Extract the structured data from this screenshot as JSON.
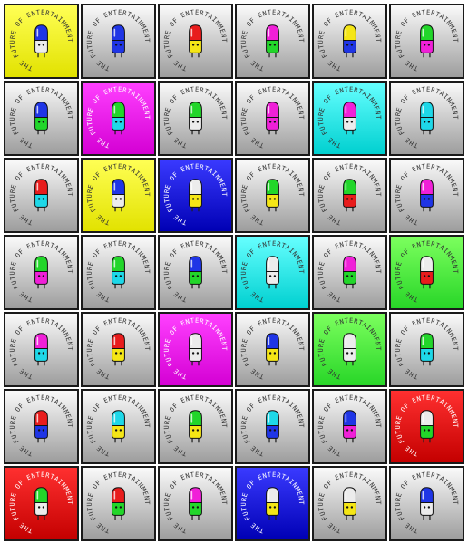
{
  "ring_text": "THE FUTURE OF ENTERTAINMENT",
  "backgrounds": {
    "gray": [
      "#fafafa",
      "#9d9d9d"
    ],
    "yellow": [
      "#ffff55",
      "#e2e200"
    ],
    "magenta": [
      "#ff40ff",
      "#d400d4"
    ],
    "cyan": [
      "#66ffff",
      "#00d0d0"
    ],
    "blue": [
      "#3a3aff",
      "#0000b4"
    ],
    "green": [
      "#7cff5e",
      "#28d628"
    ],
    "red": [
      "#ff3030",
      "#c40000"
    ]
  },
  "body_colors": {
    "blue": "#1f35e6",
    "red": "#e81c1c",
    "yellow": "#f5e616",
    "green": "#22d62a",
    "magenta": "#f020d8",
    "cyan": "#1ed8e8",
    "white": "#ececec"
  },
  "tiles": [
    {
      "bg": "yellow",
      "top": "blue",
      "bottom": "white"
    },
    {
      "bg": "gray",
      "top": "blue",
      "bottom": "blue"
    },
    {
      "bg": "gray",
      "top": "red",
      "bottom": "yellow"
    },
    {
      "bg": "gray",
      "top": "magenta",
      "bottom": "green"
    },
    {
      "bg": "gray",
      "top": "yellow",
      "bottom": "blue"
    },
    {
      "bg": "gray",
      "top": "green",
      "bottom": "magenta"
    },
    {
      "bg": "gray",
      "top": "blue",
      "bottom": "green"
    },
    {
      "bg": "magenta",
      "top": "green",
      "bottom": "cyan"
    },
    {
      "bg": "gray",
      "top": "green",
      "bottom": "white"
    },
    {
      "bg": "gray",
      "top": "magenta",
      "bottom": "magenta"
    },
    {
      "bg": "cyan",
      "top": "magenta",
      "bottom": "white"
    },
    {
      "bg": "gray",
      "top": "cyan",
      "bottom": "cyan"
    },
    {
      "bg": "gray",
      "top": "red",
      "bottom": "cyan"
    },
    {
      "bg": "yellow",
      "top": "blue",
      "bottom": "white"
    },
    {
      "bg": "blue",
      "top": "white",
      "bottom": "yellow"
    },
    {
      "bg": "gray",
      "top": "green",
      "bottom": "yellow"
    },
    {
      "bg": "gray",
      "top": "green",
      "bottom": "red"
    },
    {
      "bg": "gray",
      "top": "magenta",
      "bottom": "blue"
    },
    {
      "bg": "gray",
      "top": "green",
      "bottom": "magenta"
    },
    {
      "bg": "gray",
      "top": "green",
      "bottom": "cyan"
    },
    {
      "bg": "gray",
      "top": "blue",
      "bottom": "green"
    },
    {
      "bg": "cyan",
      "top": "white",
      "bottom": "white"
    },
    {
      "bg": "gray",
      "top": "magenta",
      "bottom": "green"
    },
    {
      "bg": "green",
      "top": "white",
      "bottom": "red"
    },
    {
      "bg": "gray",
      "top": "magenta",
      "bottom": "cyan"
    },
    {
      "bg": "gray",
      "top": "red",
      "bottom": "yellow"
    },
    {
      "bg": "magenta",
      "top": "white",
      "bottom": "white"
    },
    {
      "bg": "gray",
      "top": "blue",
      "bottom": "yellow"
    },
    {
      "bg": "green",
      "top": "white",
      "bottom": "white"
    },
    {
      "bg": "gray",
      "top": "green",
      "bottom": "cyan"
    },
    {
      "bg": "gray",
      "top": "red",
      "bottom": "blue"
    },
    {
      "bg": "gray",
      "top": "cyan",
      "bottom": "yellow"
    },
    {
      "bg": "gray",
      "top": "green",
      "bottom": "yellow"
    },
    {
      "bg": "gray",
      "top": "cyan",
      "bottom": "blue"
    },
    {
      "bg": "gray",
      "top": "blue",
      "bottom": "magenta"
    },
    {
      "bg": "red",
      "top": "white",
      "bottom": "green"
    },
    {
      "bg": "red",
      "top": "green",
      "bottom": "white"
    },
    {
      "bg": "gray",
      "top": "red",
      "bottom": "green"
    },
    {
      "bg": "gray",
      "top": "magenta",
      "bottom": "green"
    },
    {
      "bg": "blue",
      "top": "white",
      "bottom": "yellow"
    },
    {
      "bg": "gray",
      "top": "white",
      "bottom": "yellow"
    },
    {
      "bg": "gray",
      "top": "blue",
      "bottom": "white"
    }
  ]
}
